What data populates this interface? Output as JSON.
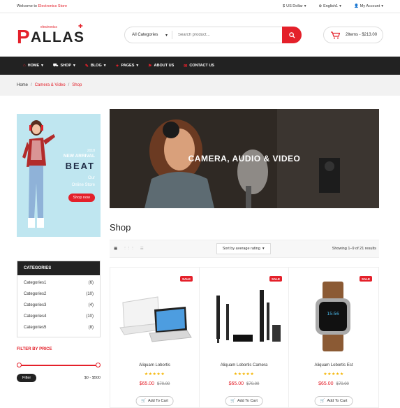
{
  "topbar": {
    "welcome": "Welcome to",
    "store": "Electronics Store",
    "currency": "US Dollar",
    "language": "English1",
    "account": "My Account"
  },
  "logo": {
    "sub": "electronics",
    "p": "P",
    "rest": "ALLAS"
  },
  "search": {
    "category": "All Categories",
    "placeholder": "Search product..."
  },
  "cart": {
    "summary": "2Items - $213.00"
  },
  "nav": [
    "HOME",
    "SHOP",
    "BLOG",
    "PAGES",
    "ABOUT US",
    "CONTACT US"
  ],
  "breadcrumb": {
    "home": "Home",
    "cat": "Camera & Video",
    "current": "Shop"
  },
  "side_banner": {
    "year": "2018",
    "new_arrival": "NEW ARRIVAL",
    "beat": "BEAT",
    "line1": "Our",
    "line2": "Online Store",
    "button": "Shop now"
  },
  "categories": {
    "title": "CATEGORIES",
    "items": [
      {
        "name": "Categories1",
        "count": "(6)"
      },
      {
        "name": "Categories2",
        "count": "(10)"
      },
      {
        "name": "Categories3",
        "count": "(4)"
      },
      {
        "name": "Categories4",
        "count": "(10)"
      },
      {
        "name": "Categories5",
        "count": "(8)"
      }
    ]
  },
  "filter": {
    "title": "FILTER BY PRICE",
    "button": "Filter",
    "range": "$0 - $500"
  },
  "hero": {
    "text": "CAMERA, AUDIO & VIDEO"
  },
  "shop": {
    "title": "Shop",
    "sort": "Sort by average rating",
    "results": "Showing 1–9 of 21 results"
  },
  "products": [
    {
      "name": "Aliquam Lobortis",
      "price": "$65.00",
      "old": "$70.00",
      "sale": "SALE",
      "add": "Add To Cart",
      "stars": "★★★★★"
    },
    {
      "name": "Aliquam Lobortis Camera",
      "price": "$65.00",
      "old": "$70.00",
      "sale": "SALE",
      "add": "Add To Cart",
      "stars": "★★★★★"
    },
    {
      "name": "Aliquam Lobortis Est",
      "price": "$65.00",
      "old": "$70.00",
      "sale": "SALE",
      "add": "Add To Cart",
      "stars": "★★★★★"
    }
  ],
  "colors": {
    "accent": "#e4202a",
    "dark": "#222222"
  }
}
